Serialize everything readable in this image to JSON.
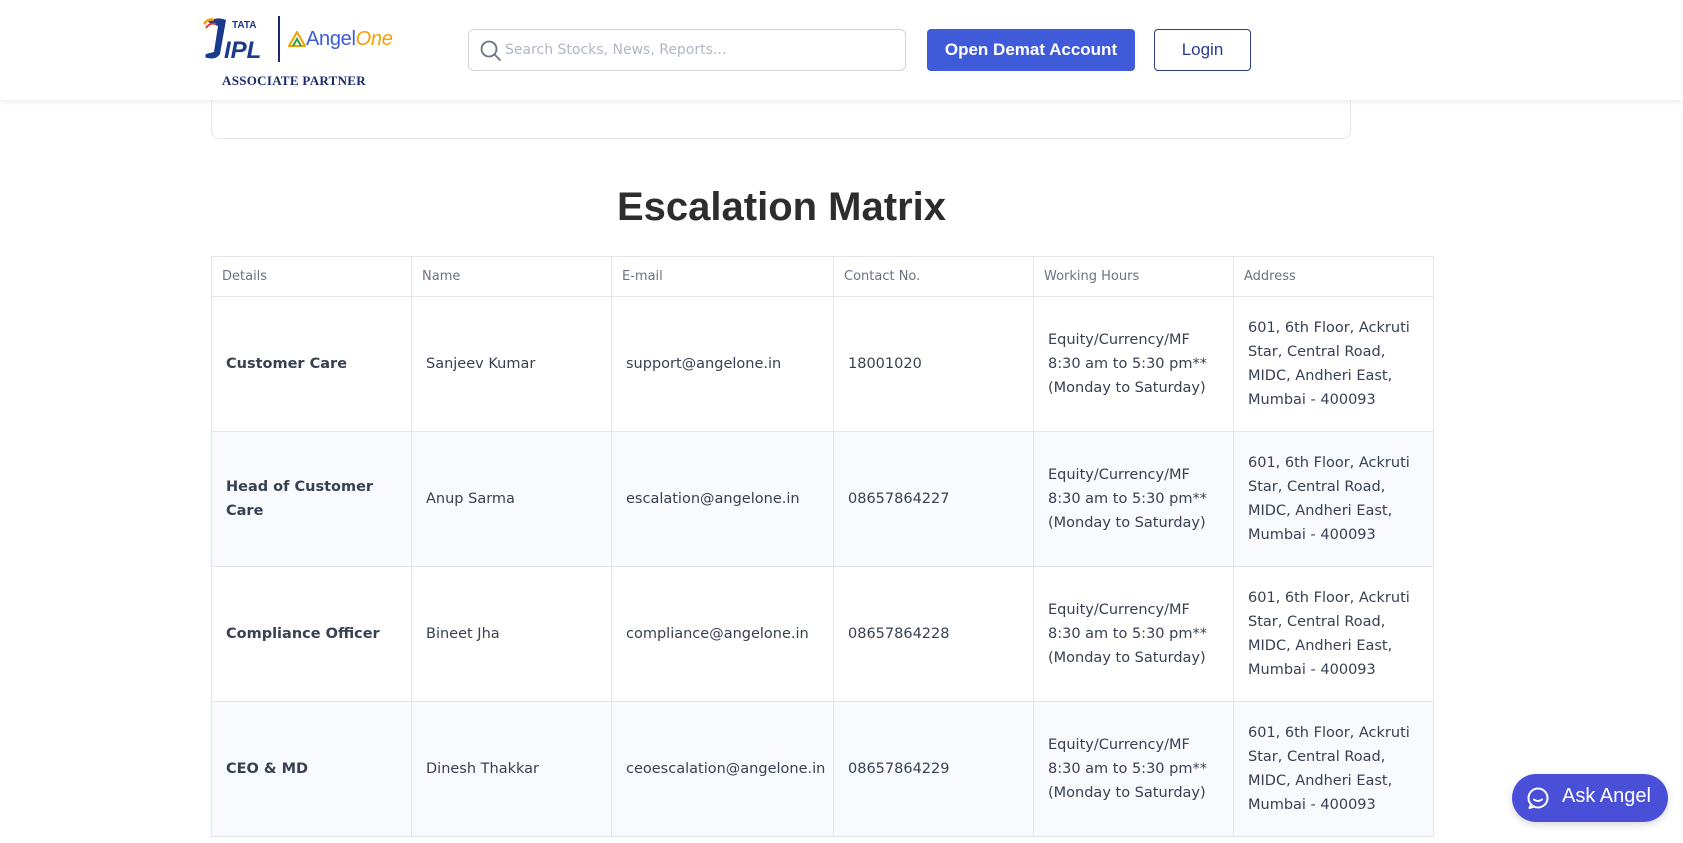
{
  "header": {
    "logo_tata": "TATA",
    "logo_ipl": "IPL",
    "logo_angel_main": "Angel",
    "logo_angel_suffix": "One",
    "logo_associate": "ASSOCIATE PARTNER",
    "search_placeholder": "Search Stocks, News, Reports...",
    "demat_label": "Open Demat Account",
    "login_label": "Login"
  },
  "colors": {
    "primary": "#3f5bd9",
    "login_border": "#2b3a8c",
    "ask_angel": "#4a4fd8"
  },
  "page": {
    "title": "Escalation Matrix"
  },
  "table": {
    "headers": [
      "Details",
      "Name",
      "E-mail",
      "Contact No.",
      "Working Hours",
      "Address"
    ],
    "rows": [
      {
        "details": "Customer Care",
        "name": "Sanjeev Kumar",
        "email": "support@angelone.in",
        "contact": "18001020",
        "hours_1": "Equity/Currency/MF",
        "hours_2": "8:30 am to 5:30 pm**",
        "hours_3": "(Monday to Saturday)",
        "address_1": "601, 6th Floor, Ackruti",
        "address_2": "Star, Central Road,",
        "address_3": "MIDC, Andheri East,",
        "address_4": "Mumbai - 400093"
      },
      {
        "details": "Head of Customer Care",
        "name": "Anup Sarma",
        "email": "escalation@angelone.in",
        "contact": "08657864227",
        "hours_1": "Equity/Currency/MF",
        "hours_2": "8:30 am to 5:30 pm**",
        "hours_3": "(Monday to Saturday)",
        "address_1": "601, 6th Floor, Ackruti",
        "address_2": "Star, Central Road,",
        "address_3": "MIDC, Andheri East,",
        "address_4": "Mumbai - 400093"
      },
      {
        "details": "Compliance Officer",
        "name": "Bineet Jha",
        "email": "compliance@angelone.in",
        "contact": "08657864228",
        "hours_1": "Equity/Currency/MF",
        "hours_2": "8:30 am to 5:30 pm**",
        "hours_3": "(Monday to Saturday)",
        "address_1": "601, 6th Floor, Ackruti",
        "address_2": "Star, Central Road,",
        "address_3": "MIDC, Andheri East,",
        "address_4": "Mumbai - 400093"
      },
      {
        "details": "CEO & MD",
        "name": "Dinesh Thakkar",
        "email": "ceoescalation@angelone.in",
        "contact": "08657864229",
        "hours_1": "Equity/Currency/MF",
        "hours_2": "8:30 am to 5:30 pm**",
        "hours_3": "(Monday to Saturday)",
        "address_1": "601, 6th Floor, Ackruti",
        "address_2": "Star, Central Road,",
        "address_3": "MIDC, Andheri East,",
        "address_4": "Mumbai - 400093"
      }
    ]
  },
  "chat": {
    "label": "Ask Angel"
  }
}
